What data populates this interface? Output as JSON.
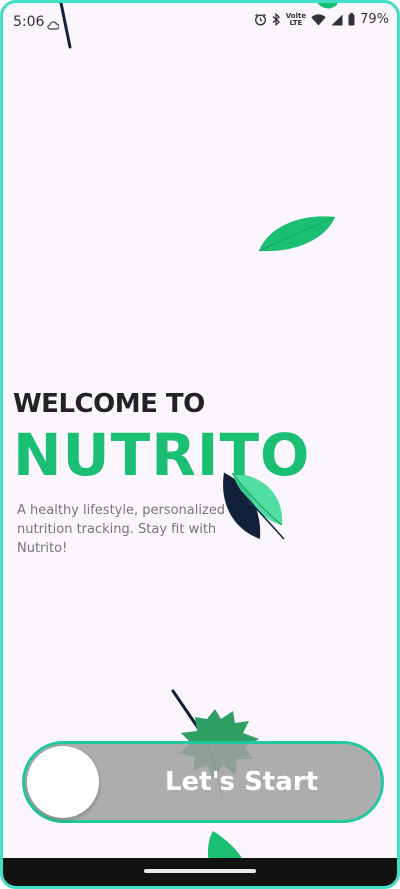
{
  "status_bar": {
    "time": "5:06",
    "network_label_top": "Volte",
    "network_label_bottom": "LTE",
    "battery": "79%",
    "icons": [
      "cloud-icon",
      "alarm-icon",
      "bluetooth-icon",
      "wifi-icon",
      "signal-icon",
      "battery-icon"
    ]
  },
  "welcome": {
    "heading": "WELCOME TO",
    "brand": "NUTRITO",
    "tagline": "A healthy lifestyle, personalized nutrition tracking. Stay fit with Nutrito!"
  },
  "cta": {
    "label": "Let's Start"
  },
  "colors": {
    "border": "#3fe0c5",
    "brand": "#1bbf73",
    "leaf_dark": "#12203a",
    "slider_border": "#22c9a0",
    "background": "#fbf6fd"
  }
}
